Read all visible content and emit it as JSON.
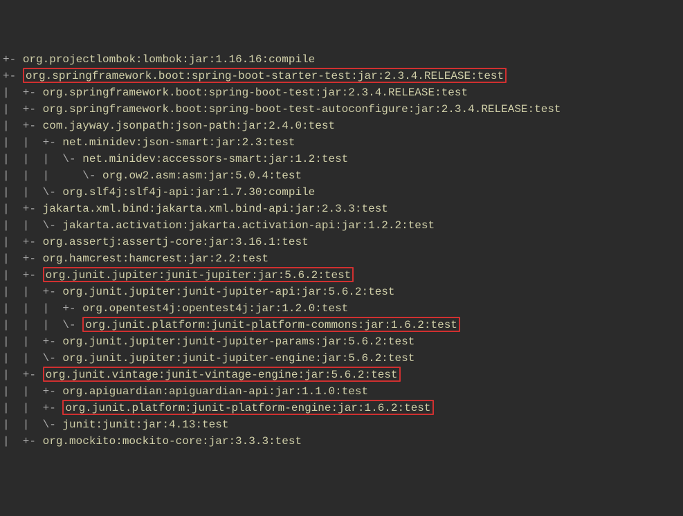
{
  "lines": [
    {
      "tree": "+- ",
      "text": "org.projectlombok:lombok:jar:1.16.16:compile",
      "hl": false
    },
    {
      "tree": "+- ",
      "text": "org.springframework.boot:spring-boot-starter-test:jar:2.3.4.RELEASE:test",
      "hl": true
    },
    {
      "tree": "|  +- ",
      "text": "org.springframework.boot:spring-boot-test:jar:2.3.4.RELEASE:test",
      "hl": false
    },
    {
      "tree": "|  +- ",
      "text": "org.springframework.boot:spring-boot-test-autoconfigure:jar:2.3.4.RELEASE:test",
      "hl": false
    },
    {
      "tree": "|  +- ",
      "text": "com.jayway.jsonpath:json-path:jar:2.4.0:test",
      "hl": false
    },
    {
      "tree": "|  |  +- ",
      "text": "net.minidev:json-smart:jar:2.3:test",
      "hl": false
    },
    {
      "tree": "|  |  |  \\- ",
      "text": "net.minidev:accessors-smart:jar:1.2:test",
      "hl": false
    },
    {
      "tree": "|  |  |     \\- ",
      "text": "org.ow2.asm:asm:jar:5.0.4:test",
      "hl": false
    },
    {
      "tree": "|  |  \\- ",
      "text": "org.slf4j:slf4j-api:jar:1.7.30:compile",
      "hl": false
    },
    {
      "tree": "|  +- ",
      "text": "jakarta.xml.bind:jakarta.xml.bind-api:jar:2.3.3:test",
      "hl": false
    },
    {
      "tree": "|  |  \\- ",
      "text": "jakarta.activation:jakarta.activation-api:jar:1.2.2:test",
      "hl": false
    },
    {
      "tree": "|  +- ",
      "text": "org.assertj:assertj-core:jar:3.16.1:test",
      "hl": false
    },
    {
      "tree": "|  +- ",
      "text": "org.hamcrest:hamcrest:jar:2.2:test",
      "hl": false
    },
    {
      "tree": "|  +- ",
      "text": "org.junit.jupiter:junit-jupiter:jar:5.6.2:test",
      "hl": true
    },
    {
      "tree": "|  |  +- ",
      "text": "org.junit.jupiter:junit-jupiter-api:jar:5.6.2:test",
      "hl": false
    },
    {
      "tree": "|  |  |  +- ",
      "text": "org.opentest4j:opentest4j:jar:1.2.0:test",
      "hl": false
    },
    {
      "tree": "|  |  |  \\- ",
      "text": "org.junit.platform:junit-platform-commons:jar:1.6.2:test",
      "hl": true
    },
    {
      "tree": "|  |  +- ",
      "text": "org.junit.jupiter:junit-jupiter-params:jar:5.6.2:test",
      "hl": false
    },
    {
      "tree": "|  |  \\- ",
      "text": "org.junit.jupiter:junit-jupiter-engine:jar:5.6.2:test",
      "hl": false
    },
    {
      "tree": "|  +- ",
      "text": "org.junit.vintage:junit-vintage-engine:jar:5.6.2:test",
      "hl": true
    },
    {
      "tree": "|  |  +- ",
      "text": "org.apiguardian:apiguardian-api:jar:1.1.0:test",
      "hl": false
    },
    {
      "tree": "|  |  +- ",
      "text": "org.junit.platform:junit-platform-engine:jar:1.6.2:test",
      "hl": true
    },
    {
      "tree": "|  |  \\- ",
      "text": "junit:junit:jar:4.13:test",
      "hl": false
    },
    {
      "tree": "|  +- ",
      "text": "org.mockito:mockito-core:jar:3.3.3:test",
      "hl": false
    }
  ]
}
